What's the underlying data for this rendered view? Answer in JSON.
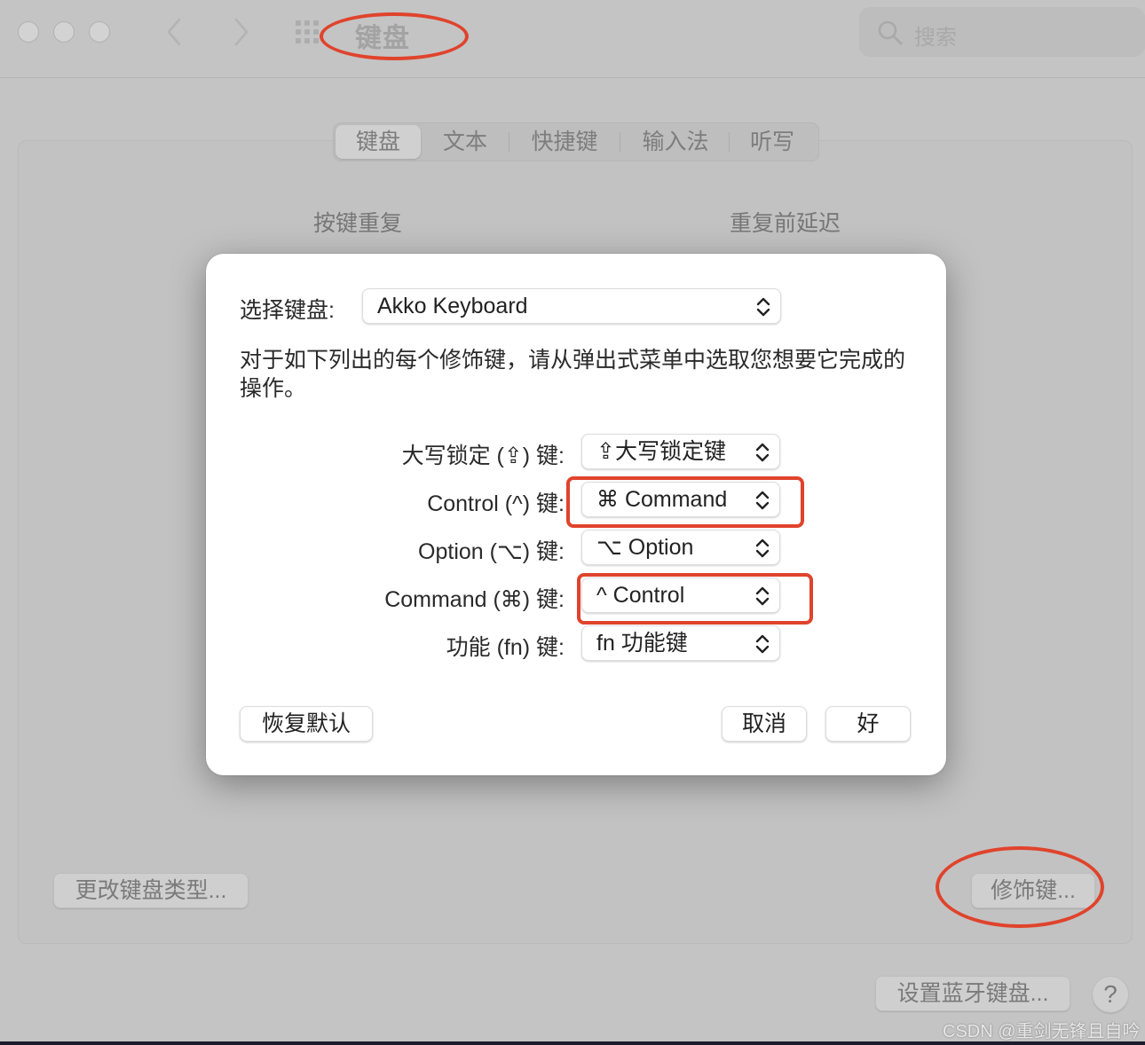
{
  "window": {
    "title": "键盘",
    "search": {
      "placeholder": "搜索",
      "value": ""
    },
    "traffic_lights": [
      "close",
      "minimize",
      "zoom"
    ],
    "nav": {
      "back_icon": "chevron-left-icon",
      "forward_icon": "chevron-right-icon",
      "grid_icon": "show-all-grid-icon"
    }
  },
  "tabs": [
    {
      "label": "键盘",
      "active": true
    },
    {
      "label": "文本",
      "active": false
    },
    {
      "label": "快捷键",
      "active": false
    },
    {
      "label": "输入法",
      "active": false
    },
    {
      "label": "听写",
      "active": false
    }
  ],
  "background_panel": {
    "key_repeat_label": "按键重复",
    "delay_until_repeat_label": "重复前延迟",
    "change_keyboard_type_button": "更改键盘类型...",
    "modifier_keys_button": "修饰键...",
    "setup_bluetooth_button": "设置蓝牙键盘...",
    "help_button": "?"
  },
  "sheet": {
    "select_keyboard_label": "选择键盘:",
    "select_keyboard_value": "Akko Keyboard",
    "description": "对于如下列出的每个修饰键，请从弹出式菜单中选取您想要它完成的操作。",
    "modifiers": [
      {
        "label": "大写锁定 (⇪) 键:",
        "value": "⇪大写锁定键",
        "highlighted": false
      },
      {
        "label": "Control (^) 键:",
        "value": "⌘ Command",
        "highlighted": true
      },
      {
        "label": "Option (⌥) 键:",
        "value": "⌥ Option",
        "highlighted": false
      },
      {
        "label": "Command (⌘) 键:",
        "value": "^ Control",
        "highlighted": true
      },
      {
        "label": "功能 (fn) 键:",
        "value": "fn 功能键",
        "highlighted": false
      }
    ],
    "restore_defaults_button": "恢复默认",
    "cancel_button": "取消",
    "ok_button": "好"
  },
  "annotation_color": "#e0432c",
  "watermark": "CSDN @重剑无锋且自吟"
}
